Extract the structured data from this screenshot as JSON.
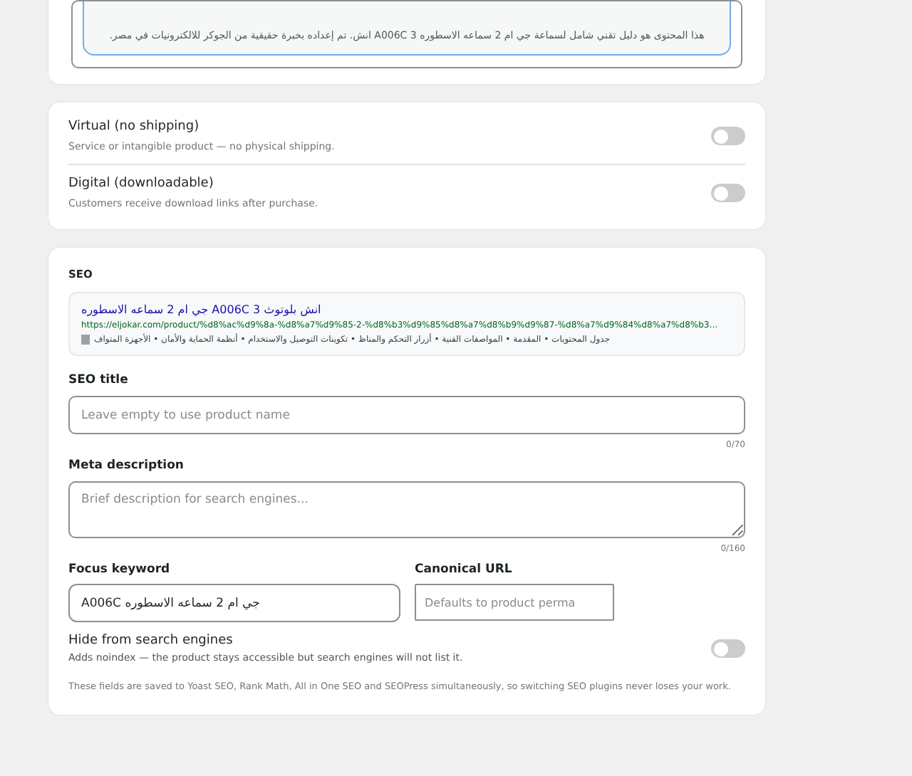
{
  "description_preview": {
    "text": "هذا المحتوى هو دليل تقني شامل لسماعة جي ام 2 سماعه الاسطوره A006C 3 انش. تم إعداده بخبرة حقيقية من الجوكر للالكترونيات في مصر."
  },
  "product_type": {
    "options": [
      {
        "label": "Virtual (no shipping)",
        "hint": "Service or intangible product — no physical shipping.",
        "on": false
      },
      {
        "label": "Digital (downloadable)",
        "hint": "Customers receive download links after purchase.",
        "on": false
      }
    ]
  },
  "seo": {
    "heading": "SEO",
    "preview": {
      "title": "انش بلوتوث 3 A006C جي ام 2 سماعه الاسطوره",
      "url": "https://eljokar.com/product/%d8%ac%d9%8a-%d8%a7%d9%85-2-%d8%b3%d9%85%d8%a7%d8%b9%d9%87-%d8%a7%d9%84%d8%a7%d8%b3…",
      "description": "جدول المحتويات • المقدمة • المواصفات الفنية • أزرار التحكم والمناظ • تكوينات التوصيل والاستخدام • أنظمة الحماية والأمان • الأجهزة المتواف"
    },
    "seo_title": {
      "label": "SEO title",
      "placeholder": "Leave empty to use product name",
      "counter": "0/70"
    },
    "meta_description": {
      "label": "Meta description",
      "placeholder": "Brief description for search engines...",
      "counter": "0/160"
    },
    "focus_keyword": {
      "label": "Focus keyword",
      "value": "A006C جي ام 2 سماعه الاسطوره"
    },
    "canonical_url": {
      "label": "Canonical URL",
      "placeholder": "Defaults to product perma"
    },
    "hide": {
      "label": "Hide from search engines",
      "hint": "Adds noindex — the product stays accessible but search engines will not list it.",
      "on": false
    },
    "note": "These fields are saved to Yoast SEO, Rank Math, All in One SEO and SEOPress simultaneously, so switching SEO plugins never loses your work."
  }
}
